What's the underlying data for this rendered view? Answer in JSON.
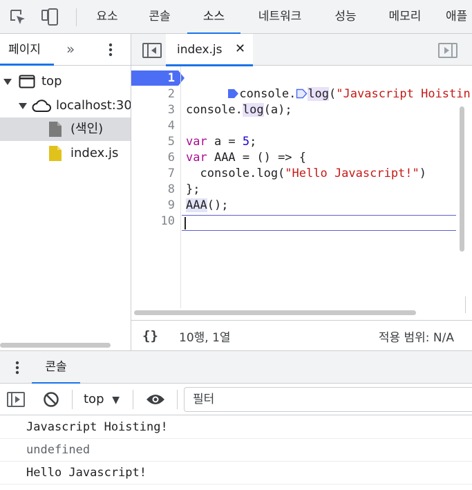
{
  "top_tabs": [
    "요소",
    "콘솔",
    "소스",
    "네트워크",
    "성능",
    "메모리",
    "애플"
  ],
  "active_top_tab": "소스",
  "navigator": {
    "tab_label": "페이지",
    "tree": [
      {
        "label": "top",
        "icon": "frame-icon",
        "expanded": true
      },
      {
        "label": "localhost:30",
        "icon": "cloud-icon",
        "expanded": true
      },
      {
        "label": "(색인)",
        "icon": "document-icon",
        "selected": true
      },
      {
        "label": "index.js",
        "icon": "script-file-icon"
      }
    ]
  },
  "editor": {
    "file_tab": "index.js",
    "close_glyph": "✕",
    "line_numbers": [
      "1",
      "2",
      "3",
      "4",
      "5",
      "6",
      "7",
      "8",
      "9",
      "10"
    ],
    "breakpoint_line": "1",
    "status_braces": "{}",
    "status_position": "10행, 1열",
    "status_coverage": "적용 범위: N/A"
  },
  "code": {
    "l1_a": "console.",
    "l1_b": "log",
    "l1_c": "(",
    "l1_str": "\"Javascript Hoistin",
    "l3_a": "console.",
    "l3_b": "log",
    "l3_c": "(a);",
    "l5_kw": "var",
    "l5_a": " a = ",
    "l5_num": "5",
    "l5_b": ";",
    "l6_kw": "var",
    "l6_a": " AAA = () => {",
    "l7_a": "  console.log(",
    "l7_str": "\"Hello Javascript!\"",
    "l7_b": ")",
    "l8": "};",
    "l9_a": "AAA",
    "l9_b": "();"
  },
  "drawer": {
    "tab_label": "콘솔",
    "context": "top",
    "context_arrow": "▼",
    "filter_placeholder": "필터"
  },
  "console_messages": [
    {
      "text": "Javascript Hoisting!",
      "muted": false
    },
    {
      "text": "undefined",
      "muted": true
    },
    {
      "text": "Hello Javascript!",
      "muted": false
    }
  ],
  "colors": {
    "accent": "#1a73e8",
    "breakpoint": "#4c6ef5",
    "keyword": "#aa0d91",
    "string": "#c41a16",
    "number": "#1c00cf"
  }
}
